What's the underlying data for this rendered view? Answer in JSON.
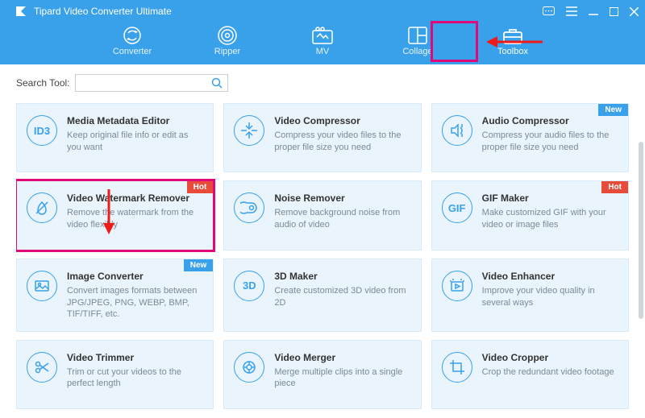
{
  "app": {
    "title": "Tipard Video Converter Ultimate"
  },
  "nav": {
    "converter": "Converter",
    "ripper": "Ripper",
    "mv": "MV",
    "collage": "Collage",
    "toolbox": "Toolbox"
  },
  "search": {
    "label": "Search Tool:"
  },
  "badges": {
    "hot": "Hot",
    "new": "New"
  },
  "cards": {
    "media_metadata": {
      "icon": "ID3",
      "title": "Media Metadata Editor",
      "desc": "Keep original file info or edit as you want"
    },
    "video_compressor": {
      "title": "Video Compressor",
      "desc": "Compress your video files to the proper file size you need"
    },
    "audio_compressor": {
      "title": "Audio Compressor",
      "desc": "Compress your audio files to the proper file size you need"
    },
    "watermark_remover": {
      "title": "Video Watermark Remover",
      "desc": "Remove the watermark from the video flexibly"
    },
    "noise_remover": {
      "title": "Noise Remover",
      "desc": "Remove background noise from audio of video"
    },
    "gif_maker": {
      "icon": "GIF",
      "title": "GIF Maker",
      "desc": "Make customized GIF with your video or image files"
    },
    "image_converter": {
      "title": "Image Converter",
      "desc": "Convert images formats between JPG/JPEG, PNG, WEBP, BMP, TIF/TIFF, etc."
    },
    "three_d_maker": {
      "icon": "3D",
      "title": "3D Maker",
      "desc": "Create customized 3D video from 2D"
    },
    "video_enhancer": {
      "title": "Video Enhancer",
      "desc": "Improve your video quality in several ways"
    },
    "video_trimmer": {
      "title": "Video Trimmer",
      "desc": "Trim or cut your videos to the perfect length"
    },
    "video_merger": {
      "title": "Video Merger",
      "desc": "Merge multiple clips into a single piece"
    },
    "video_cropper": {
      "title": "Video Cropper",
      "desc": "Crop the redundant video footage"
    }
  }
}
